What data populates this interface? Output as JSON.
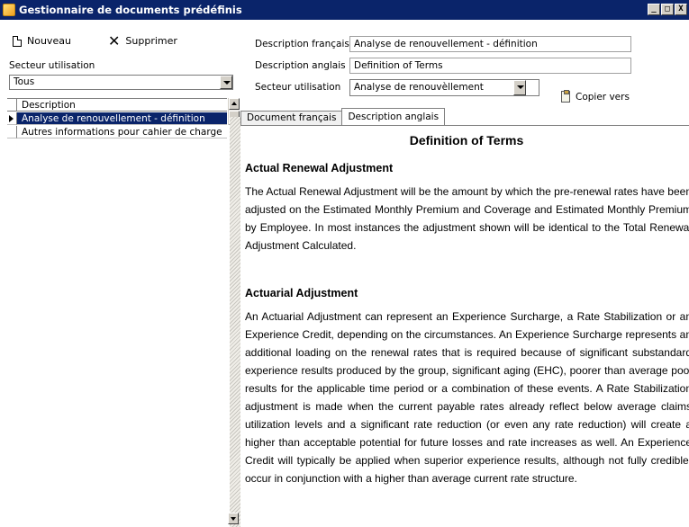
{
  "window": {
    "title": "Gestionnaire de documents prédéfinis",
    "controls": [
      "_",
      "□",
      "X"
    ]
  },
  "toolbar": {
    "new_label": "Nouveau",
    "delete_label": "Supprimer"
  },
  "filter": {
    "label": "Secteur utilisation",
    "value": "Tous"
  },
  "list": {
    "header": "Description",
    "rows": [
      {
        "label": "Analyse de renouvellement - définition",
        "selected": true
      },
      {
        "label": "Autres informations pour cahier de charge",
        "selected": false
      }
    ]
  },
  "form": {
    "desc_fr_label": "Description français",
    "desc_fr_value": "Analyse de renouvellement - définition",
    "desc_en_label": "Description anglais",
    "desc_en_value": "Definition of Terms",
    "sector_label": "Secteur utilisation",
    "sector_value": "Analyse de renouvèllement",
    "copy_label": "Copier vers"
  },
  "tabs": [
    {
      "label": "Document français",
      "active": false
    },
    {
      "label": "Description anglais",
      "active": true
    }
  ],
  "document": {
    "title": "Definition of Terms",
    "section1_heading": "Actual Renewal Adjustment",
    "section1_body": "The Actual Renewal Adjustment will be the amount by which the pre-renewal rates have been adjusted on the Estimated Monthly Premium and Coverage and Estimated Monthly Premium by Employee. In most instances the adjustment shown will be identical to the Total Renewal Adjustment Calculated.",
    "section2_heading": "Actuarial Adjustment",
    "section2_body": "An Actuarial Adjustment can represent an Experience Surcharge, a Rate Stabilization or an Experience Credit, depending on the circumstances. An Experience Surcharge represents an additional loading on the renewal rates that is required because of significant substandard experience results produced by the group, significant aging (EHC), poorer than average pool results for the applicable time period or a combination of these events. A Rate Stabilization adjustment is made when the current payable rates already reflect below average claims utilization levels and a significant rate reduction (or even any rate reduction) will create a higher than acceptable potential for future losses and rate increases as well. An Experience Credit will typically be applied when superior experience results, although not fully credible, occur in conjunction with a higher than average current rate structure."
  },
  "colors": {
    "titlebar": "#0a246a",
    "selection": "#0a246a"
  }
}
